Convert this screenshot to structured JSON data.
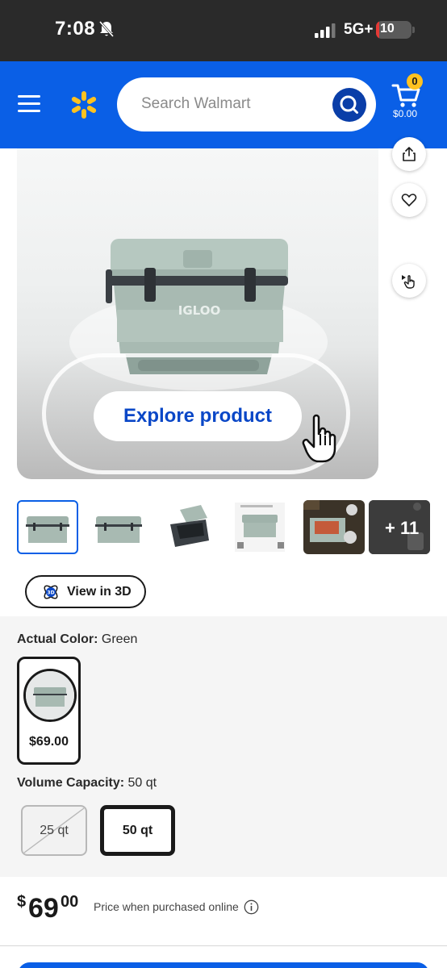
{
  "status_bar": {
    "time": "7:08",
    "network": "5G+",
    "battery": "10",
    "battery_level_percent": 10
  },
  "header": {
    "search_placeholder": "Search Walmart",
    "cart_count": "0",
    "cart_total": "$0.00",
    "brand_color": "#0a5fe6",
    "spark_color": "#ffc220"
  },
  "product_image": {
    "brand_text": "IGLOO",
    "explore_label": "Explore product"
  },
  "thumbnails": {
    "more_label": "+ 11"
  },
  "view3d": {
    "badge": "3D",
    "label": "View in 3D"
  },
  "variants": {
    "color_label": "Actual Color:",
    "color_value": "Green",
    "color_price": "$69.00",
    "volume_label": "Volume Capacity:",
    "volume_value": "50 qt",
    "volume_options": [
      "25 qt",
      "50 qt"
    ]
  },
  "price": {
    "currency": "$",
    "dollars": "69",
    "cents": "00",
    "note": "Price when purchased online"
  }
}
